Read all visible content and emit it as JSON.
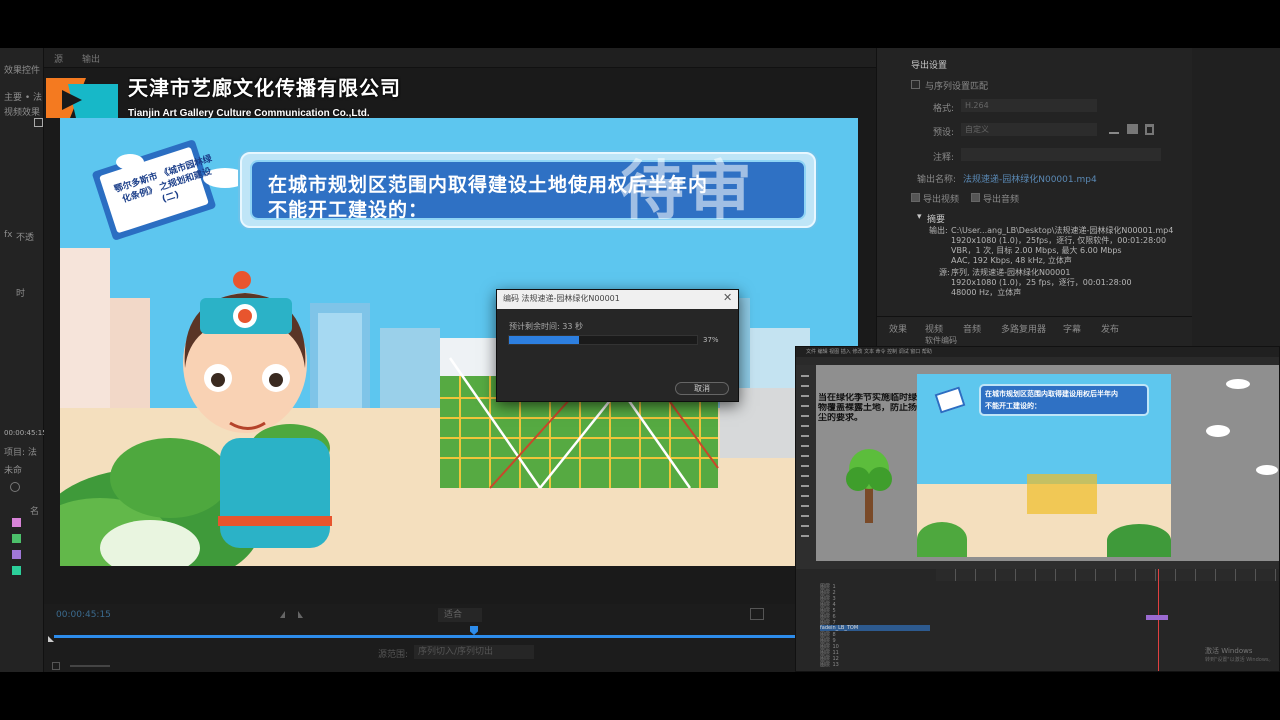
{
  "watermark": {
    "company_cn": "天津市艺廊文化传播有限公司",
    "company_en": "Tianjin Art Gallery Culture Communication Co.,Ltd."
  },
  "premiere": {
    "left_panel": [
      "效果控件",
      "主要 • 法",
      "视频效果",
      "fx",
      "不透",
      "时"
    ],
    "left_panel_time": "00:00:45:15",
    "left_panel_project": [
      "项目: 法",
      "未命",
      "名"
    ],
    "program_tabs": [
      "源",
      "输出"
    ],
    "timecode": "00:00:45:15",
    "zoom": "适合",
    "range_label": "源范围:",
    "range_value": "序列切入/序列切出"
  },
  "export_settings": {
    "title": "导出设置",
    "match_sequence": "与序列设置匹配",
    "format_label": "格式:",
    "format_value": "H.264",
    "preset_label": "预设:",
    "preset_value": "自定义",
    "comment_label": "注释:",
    "output_name_label": "输出名称:",
    "output_name": "法规速递-园林绿化N00001.mp4",
    "export_video": "导出视频",
    "export_audio": "导出音频",
    "summary_title": "摘要",
    "output_label": "输出:",
    "output_lines": [
      "C:\\User...ang_LB\\Desktop\\法规速递-园林绿化N00001.mp4",
      "1920x1080 (1.0)，25fps，逐行, 仅限软件，00:01:28:00",
      "VBR，1 次, 目标 2.00 Mbps, 最大 6.00 Mbps",
      "AAC, 192 Kbps, 48 kHz, 立体声"
    ],
    "source_label": "源:",
    "source_lines": [
      "序列, 法规速递-园林绿化N00001",
      "1920x1080 (1.0)，25 fps，逐行，00:01:28:00",
      "48000 Hz，立体声"
    ],
    "bottom_tabs": [
      "效果",
      "视频",
      "音频",
      "多路复用器",
      "字幕",
      "发布"
    ],
    "render_label": "软件编码"
  },
  "encoding_dialog": {
    "title": "编码 法规速递-园林绿化N00001",
    "eta": "预计剩余时间: 33 秒",
    "progress": 0.37,
    "progress_label": "37%",
    "cancel": "取消"
  },
  "video": {
    "banner_line1": "在城市规划区范围内取得建设土地使用权后半年内",
    "banner_line2": "不能开工建设的：",
    "stamp": "待审",
    "sign_text": "鄂尔多斯市 《城市园林绿化条例》 之规划和建设(二)"
  },
  "animate": {
    "menu": "文件 编辑 视图 插入 修改 文本 命令 控制 调试 窗口 帮助",
    "left_text": [
      "当在绿化季节实施临时绿",
      "物覆盖裸露土地，防止扬",
      "尘的要求。"
    ],
    "canvas_line1": "在城市规划区范围内取得建设用权后半年内",
    "canvas_line2": "不能开工建设的：",
    "layers": [
      "图层_1",
      "图层_2",
      "图层_3",
      "图层_4",
      "图层_5",
      "图层_6",
      "图层_7",
      "fadein_LB_TOM",
      "图层_8",
      "图层_9",
      "图层_10",
      "图层_11",
      "图层_12",
      "图层_13"
    ],
    "watermark_1": "激活 Windows",
    "watermark_2": "转到\"设置\"以激活 Windows。"
  },
  "colors": {
    "accent_blue": "#2d7fe0",
    "sky": "#5dc6ef",
    "banner_blue": "#2f71c4"
  }
}
